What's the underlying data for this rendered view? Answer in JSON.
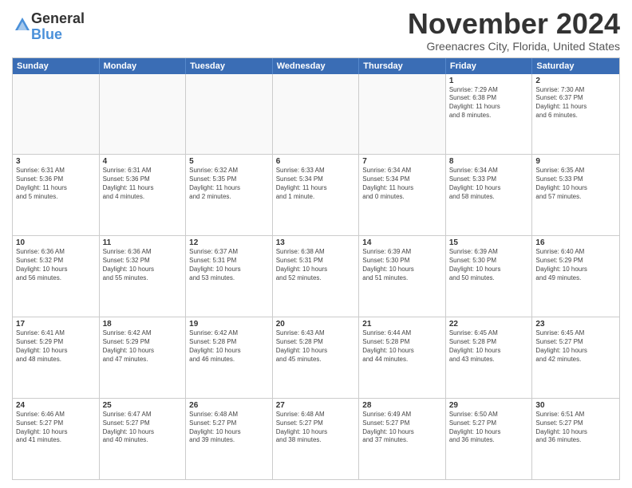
{
  "logo": {
    "general": "General",
    "blue": "Blue"
  },
  "header": {
    "month": "November 2024",
    "location": "Greenacres City, Florida, United States"
  },
  "weekdays": [
    "Sunday",
    "Monday",
    "Tuesday",
    "Wednesday",
    "Thursday",
    "Friday",
    "Saturday"
  ],
  "rows": [
    [
      {
        "day": "",
        "text": ""
      },
      {
        "day": "",
        "text": ""
      },
      {
        "day": "",
        "text": ""
      },
      {
        "day": "",
        "text": ""
      },
      {
        "day": "",
        "text": ""
      },
      {
        "day": "1",
        "text": "Sunrise: 7:29 AM\nSunset: 6:38 PM\nDaylight: 11 hours\nand 8 minutes."
      },
      {
        "day": "2",
        "text": "Sunrise: 7:30 AM\nSunset: 6:37 PM\nDaylight: 11 hours\nand 6 minutes."
      }
    ],
    [
      {
        "day": "3",
        "text": "Sunrise: 6:31 AM\nSunset: 5:36 PM\nDaylight: 11 hours\nand 5 minutes."
      },
      {
        "day": "4",
        "text": "Sunrise: 6:31 AM\nSunset: 5:36 PM\nDaylight: 11 hours\nand 4 minutes."
      },
      {
        "day": "5",
        "text": "Sunrise: 6:32 AM\nSunset: 5:35 PM\nDaylight: 11 hours\nand 2 minutes."
      },
      {
        "day": "6",
        "text": "Sunrise: 6:33 AM\nSunset: 5:34 PM\nDaylight: 11 hours\nand 1 minute."
      },
      {
        "day": "7",
        "text": "Sunrise: 6:34 AM\nSunset: 5:34 PM\nDaylight: 11 hours\nand 0 minutes."
      },
      {
        "day": "8",
        "text": "Sunrise: 6:34 AM\nSunset: 5:33 PM\nDaylight: 10 hours\nand 58 minutes."
      },
      {
        "day": "9",
        "text": "Sunrise: 6:35 AM\nSunset: 5:33 PM\nDaylight: 10 hours\nand 57 minutes."
      }
    ],
    [
      {
        "day": "10",
        "text": "Sunrise: 6:36 AM\nSunset: 5:32 PM\nDaylight: 10 hours\nand 56 minutes."
      },
      {
        "day": "11",
        "text": "Sunrise: 6:36 AM\nSunset: 5:32 PM\nDaylight: 10 hours\nand 55 minutes."
      },
      {
        "day": "12",
        "text": "Sunrise: 6:37 AM\nSunset: 5:31 PM\nDaylight: 10 hours\nand 53 minutes."
      },
      {
        "day": "13",
        "text": "Sunrise: 6:38 AM\nSunset: 5:31 PM\nDaylight: 10 hours\nand 52 minutes."
      },
      {
        "day": "14",
        "text": "Sunrise: 6:39 AM\nSunset: 5:30 PM\nDaylight: 10 hours\nand 51 minutes."
      },
      {
        "day": "15",
        "text": "Sunrise: 6:39 AM\nSunset: 5:30 PM\nDaylight: 10 hours\nand 50 minutes."
      },
      {
        "day": "16",
        "text": "Sunrise: 6:40 AM\nSunset: 5:29 PM\nDaylight: 10 hours\nand 49 minutes."
      }
    ],
    [
      {
        "day": "17",
        "text": "Sunrise: 6:41 AM\nSunset: 5:29 PM\nDaylight: 10 hours\nand 48 minutes."
      },
      {
        "day": "18",
        "text": "Sunrise: 6:42 AM\nSunset: 5:29 PM\nDaylight: 10 hours\nand 47 minutes."
      },
      {
        "day": "19",
        "text": "Sunrise: 6:42 AM\nSunset: 5:28 PM\nDaylight: 10 hours\nand 46 minutes."
      },
      {
        "day": "20",
        "text": "Sunrise: 6:43 AM\nSunset: 5:28 PM\nDaylight: 10 hours\nand 45 minutes."
      },
      {
        "day": "21",
        "text": "Sunrise: 6:44 AM\nSunset: 5:28 PM\nDaylight: 10 hours\nand 44 minutes."
      },
      {
        "day": "22",
        "text": "Sunrise: 6:45 AM\nSunset: 5:28 PM\nDaylight: 10 hours\nand 43 minutes."
      },
      {
        "day": "23",
        "text": "Sunrise: 6:45 AM\nSunset: 5:27 PM\nDaylight: 10 hours\nand 42 minutes."
      }
    ],
    [
      {
        "day": "24",
        "text": "Sunrise: 6:46 AM\nSunset: 5:27 PM\nDaylight: 10 hours\nand 41 minutes."
      },
      {
        "day": "25",
        "text": "Sunrise: 6:47 AM\nSunset: 5:27 PM\nDaylight: 10 hours\nand 40 minutes."
      },
      {
        "day": "26",
        "text": "Sunrise: 6:48 AM\nSunset: 5:27 PM\nDaylight: 10 hours\nand 39 minutes."
      },
      {
        "day": "27",
        "text": "Sunrise: 6:48 AM\nSunset: 5:27 PM\nDaylight: 10 hours\nand 38 minutes."
      },
      {
        "day": "28",
        "text": "Sunrise: 6:49 AM\nSunset: 5:27 PM\nDaylight: 10 hours\nand 37 minutes."
      },
      {
        "day": "29",
        "text": "Sunrise: 6:50 AM\nSunset: 5:27 PM\nDaylight: 10 hours\nand 36 minutes."
      },
      {
        "day": "30",
        "text": "Sunrise: 6:51 AM\nSunset: 5:27 PM\nDaylight: 10 hours\nand 36 minutes."
      }
    ]
  ]
}
